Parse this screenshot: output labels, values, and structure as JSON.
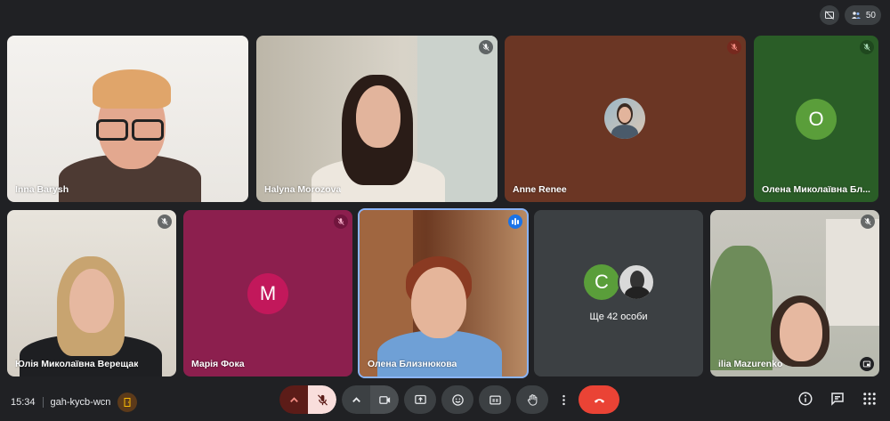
{
  "top_bar": {
    "participants_count": "50",
    "icons": [
      "camera-off-icon",
      "people-icon"
    ]
  },
  "tiles": {
    "t1": {
      "name": "Inna Barysh"
    },
    "t2": {
      "name": "Halyna Morozova"
    },
    "t3": {
      "name": "Anne Renee"
    },
    "t4": {
      "name": "Олена Миколаївна Бл...",
      "initial": "О"
    },
    "t5": {
      "name": "Юлія Миколаївна Верещак"
    },
    "t6": {
      "name": "Марія Фока",
      "initial": "M"
    },
    "t7": {
      "name": "Олена Близнюкова"
    },
    "t8": {
      "others_label": "Ще 42 особи",
      "initial": "C"
    },
    "t9": {
      "name": "ilia Mazurenko"
    }
  },
  "bottom_bar": {
    "time": "15:34",
    "meeting_code": "gah-kycb-wcn"
  },
  "colors": {
    "background": "#202124",
    "tile_brown": "#6b3624",
    "tile_green": "#2a5d27",
    "tile_magenta": "#8c1f4e",
    "tile_grey": "#3c4043",
    "avatar_green": "#5a9e3a",
    "avatar_magenta": "#c2185b",
    "end_call": "#ea4335"
  }
}
